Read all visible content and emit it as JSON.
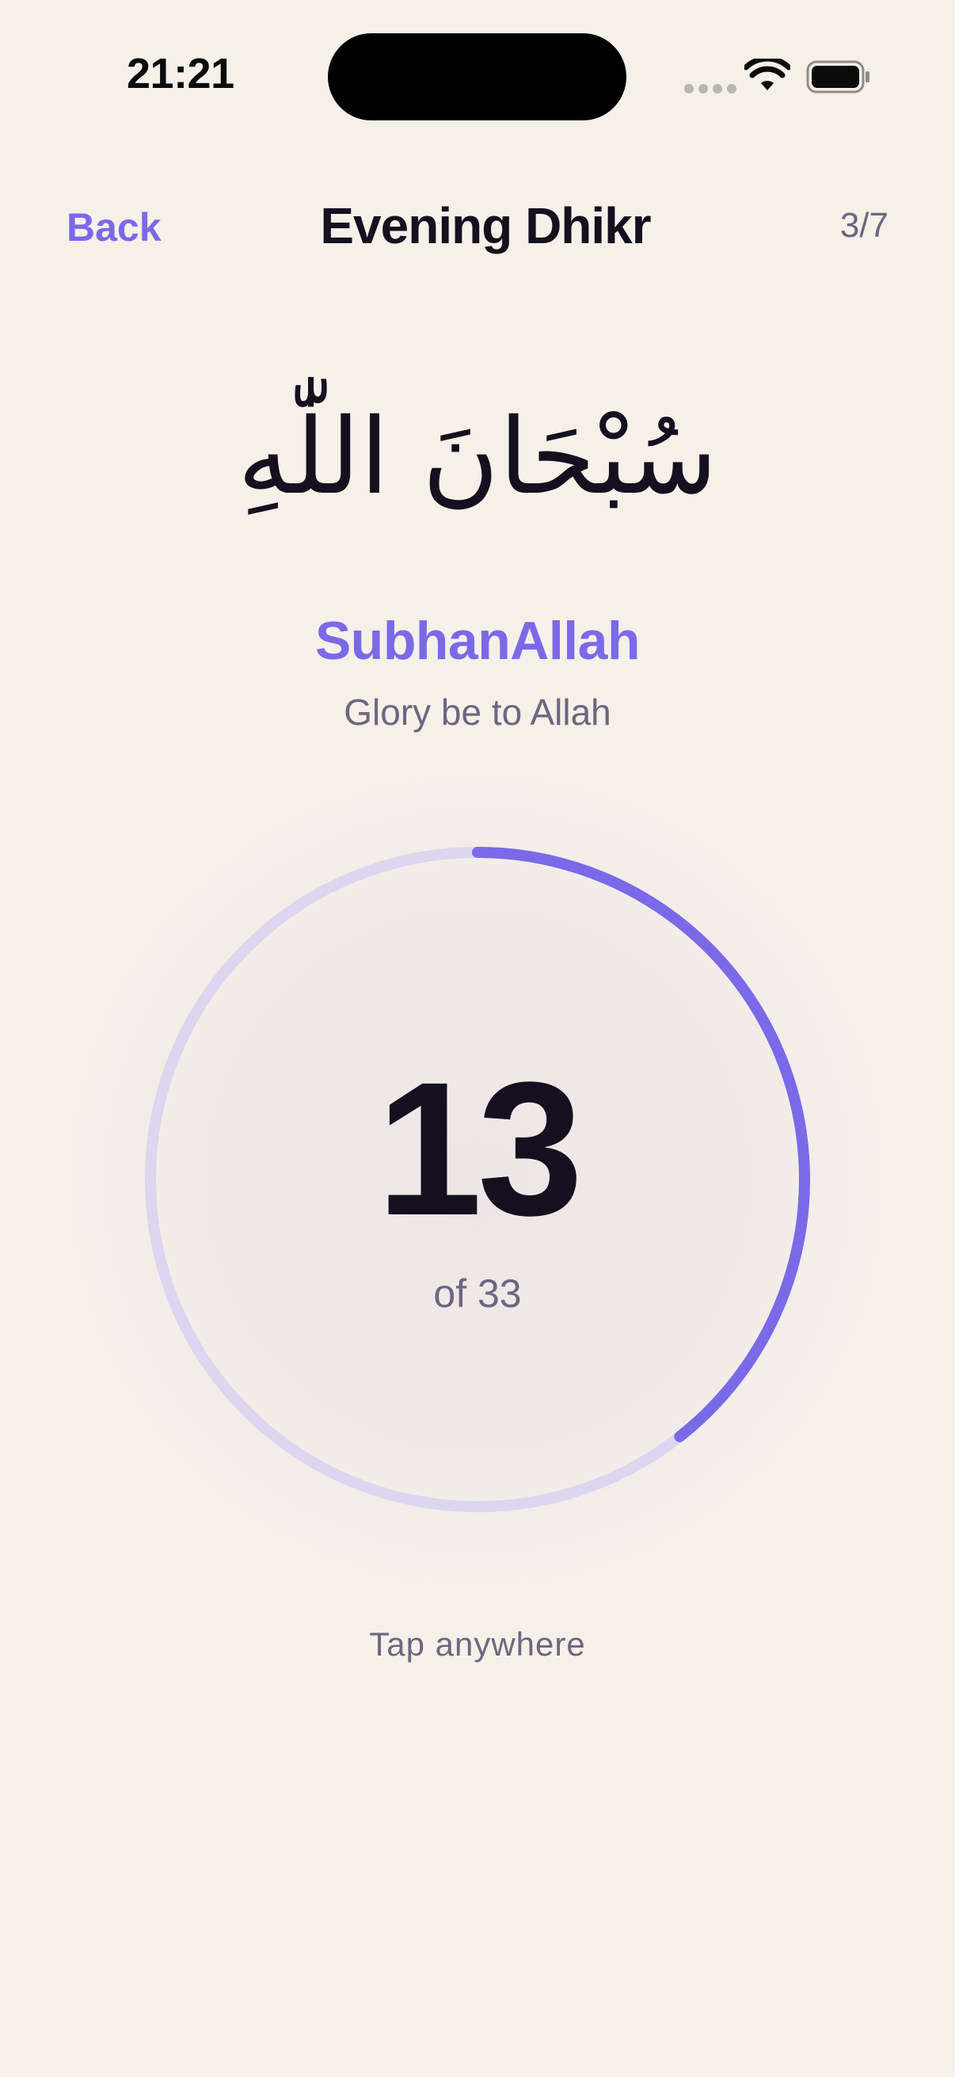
{
  "status_bar": {
    "time": "21:21"
  },
  "nav": {
    "back_label": "Back",
    "title": "Evening Dhikr",
    "progress": "3/7"
  },
  "dhikr": {
    "arabic": "سُبْحَانَ اللّٰهِ",
    "transliteration": "SubhanAllah",
    "translation": "Glory be to Allah"
  },
  "counter": {
    "count": "13",
    "total_label": "of 33",
    "current": 13,
    "target": 33
  },
  "hint": "Tap anywhere",
  "colors": {
    "background": "#F5F0E8",
    "accent": "#7B69E8",
    "ring_track": "#DDD6F0",
    "text_primary": "#15101F",
    "text_secondary": "#6D6680"
  },
  "icons": {
    "wifi": "wifi-icon",
    "battery": "battery-icon",
    "signal": "cellular-signal-icon"
  }
}
